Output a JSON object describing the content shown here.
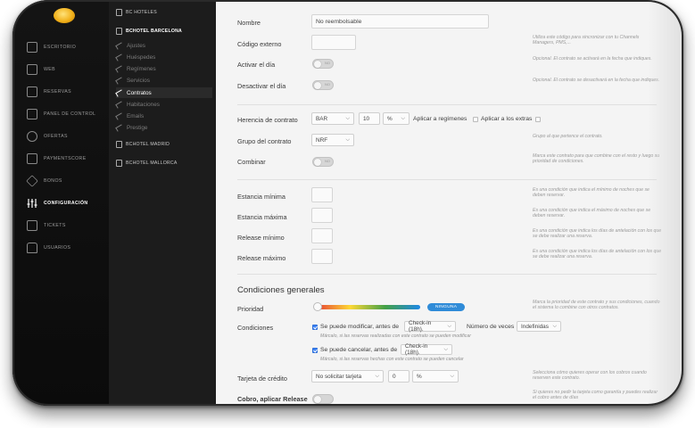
{
  "colors": {
    "accent_blue": "#3b82f6",
    "badge_blue": "#2f8bd8",
    "logo_gold": "#f1b11b",
    "priority_gradient": [
      "#e53935",
      "#fdd835",
      "#43a047",
      "#1e88e5"
    ]
  },
  "rail": {
    "items": [
      {
        "label": "ESCRITORIO",
        "icon": "monitor-icon"
      },
      {
        "label": "WEB",
        "icon": "web-page-icon"
      },
      {
        "label": "RESERVAS",
        "icon": "bed-icon"
      },
      {
        "label": "PANEL DE CONTROL",
        "icon": "calendar-icon"
      },
      {
        "label": "OFERTAS",
        "icon": "discount-icon"
      },
      {
        "label": "PAYMENTSCORE",
        "icon": "card-icon"
      },
      {
        "label": "BONOS",
        "icon": "tag-icon"
      },
      {
        "label": "CONFIGURACIÓN",
        "icon": "sliders-icon"
      },
      {
        "label": "TICKETS",
        "icon": "chat-icon"
      },
      {
        "label": "USUARIOS",
        "icon": "users-icon"
      }
    ],
    "active_index": 7
  },
  "tree": {
    "hotels_header": "BC HOTELES",
    "barcelona": "BCHOTEL BARCELONA",
    "children": [
      "Ajustes",
      "Huéspedes",
      "Regímenes",
      "Servicios",
      "Contratos",
      "Habitaciones",
      "Emails",
      "Prestige"
    ],
    "active_child": 4,
    "madrid": "BCHOTEL MADRID",
    "mallorca": "BCHOTEL MALLORCA"
  },
  "form": {
    "nombre": {
      "label": "Nombre",
      "value": "No reembolsable"
    },
    "codigo": {
      "label": "Código externo",
      "value": "",
      "hint": "Utiliza este código para sincronizar con tu Channels Managers, PMS,..."
    },
    "activar": {
      "label": "Activar el día",
      "hint": "Opcional. El contrato se activará en la fecha que indiques.",
      "toggle_text": "NO"
    },
    "desactivar": {
      "label": "Desactivar el día",
      "hint": "Opcional. El contrato se desactivará en la fecha que indiques.",
      "toggle_text": "NO"
    },
    "herencia": {
      "label": "Herencia de contrato",
      "select1": "BAR",
      "number": "10",
      "unit": "%",
      "regimenes": "Aplicar a regímenes",
      "extras": "Aplicar a los extras"
    },
    "grupo": {
      "label": "Grupo del contrato",
      "value": "NRF",
      "hint": "Grupo al que pertence el contrato."
    },
    "combinar": {
      "label": "Combinar",
      "hint": "Marca este contrato para que combine con el resto y luego su prioridad de condiciones.",
      "toggle_text": "NO"
    },
    "estancia_min": {
      "label": "Estancia mínima",
      "hint": "Es una condición que indica el mínimo de noches que se deben reservar."
    },
    "estancia_max": {
      "label": "Estancia máxima",
      "hint": "Es una condición que indica el máximo de noches que se deben reservar."
    },
    "release_min": {
      "label": "Release mínimo",
      "hint": "Es una condición que indica los días de antelación con los que se debe realizar una reserva."
    },
    "release_max": {
      "label": "Release máximo",
      "hint": "Es una condición que indica los días de antelación con los que se debe realizar una reserva."
    },
    "section_title": "Condiciones generales",
    "prioridad": {
      "label": "Prioridad",
      "badge": "NINGUNA",
      "level": 0,
      "hint": "Marca la prioridad de este contrato y sus condiciones, cuando el sistema lo combine con otros contratos."
    },
    "condiciones": {
      "label": "Condiciones",
      "modificar": "Se puede modificar, antes de",
      "modificar_select": "Check-in (18h).",
      "num_veces_label": "Número de veces",
      "num_veces_select": "Indefinidas",
      "modificar_note": "Márcalo, si las reservas realizadas con este contrato se pueden modificar",
      "cancelar": "Se puede cancelar, antes de",
      "cancelar_select": "Check-in (18h).",
      "cancelar_note": "Márcalo, si las reservas hechas con este contrato se pueden cancelar"
    },
    "tarjeta": {
      "label": "Tarjeta de crédito",
      "select": "No solicitar tarjeta",
      "number": "0",
      "unit": "%",
      "hint": "Selecciona cómo quieres operar con los cobros cuando reserven este contrato."
    },
    "cobro": {
      "label": "Cobro, aplicar Release",
      "hint": "Si quieres no pedir la tarjeta como garantía y puedes realizar el cobro antes de días"
    }
  }
}
